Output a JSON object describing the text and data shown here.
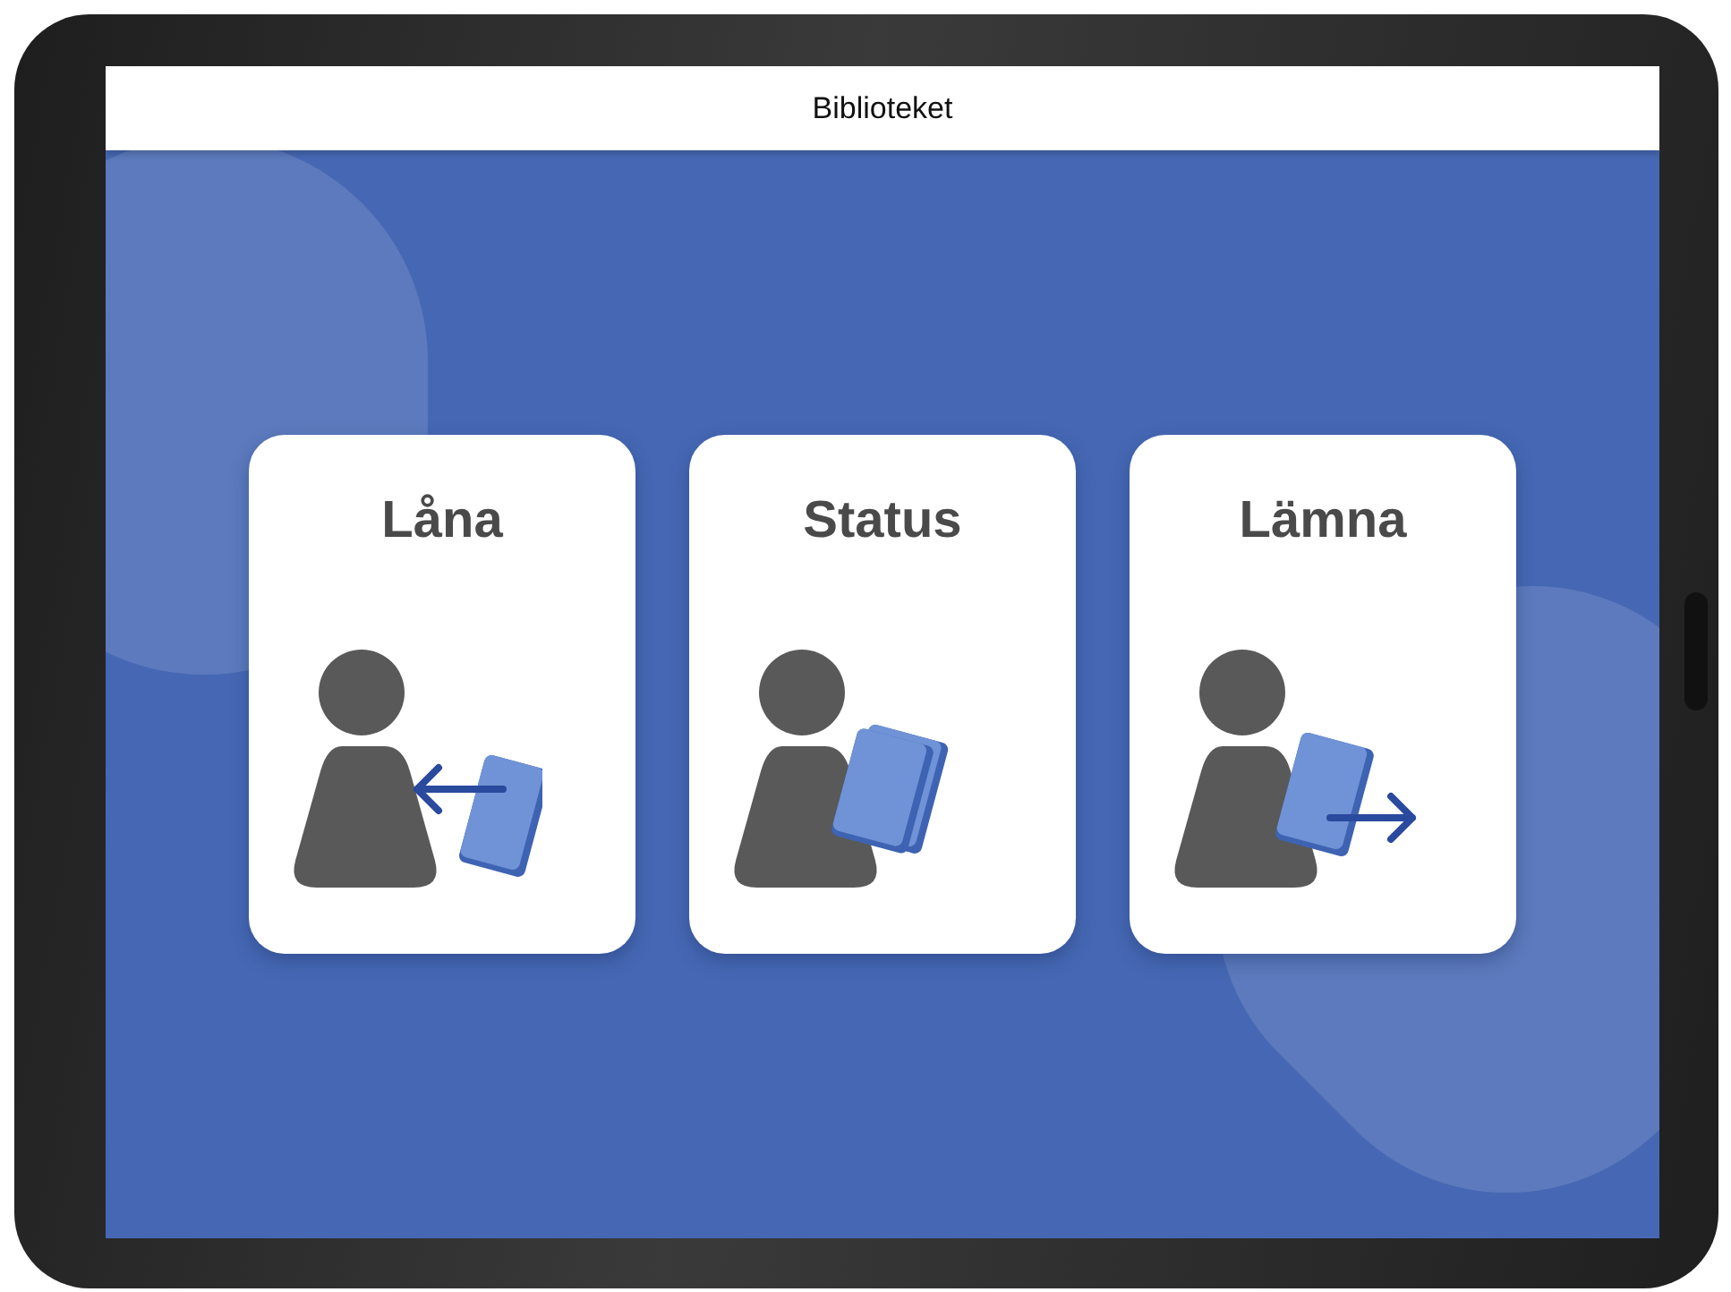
{
  "app": {
    "title": "Biblioteket"
  },
  "options": [
    {
      "label": "Låna",
      "kind": "borrow"
    },
    {
      "label": "Status",
      "kind": "status"
    },
    {
      "label": "Lämna",
      "kind": "return"
    }
  ]
}
